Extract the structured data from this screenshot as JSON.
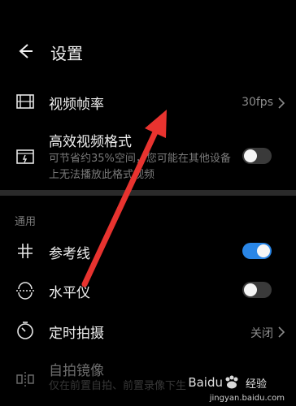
{
  "header": {
    "title": "设置"
  },
  "items": [
    {
      "label": "视频帧率",
      "value": "30fps"
    },
    {
      "label": "高效视频格式",
      "desc": "可节省约35%空间，您可能在其他设备上无法播放此格式视频",
      "toggle_on": false
    },
    {
      "label": "参考线",
      "toggle_on": true
    },
    {
      "label": "水平仪",
      "toggle_on": false
    },
    {
      "label": "定时拍摄",
      "value": "关闭"
    },
    {
      "label": "自拍镜像",
      "desc": "仅在前置自拍、前置录像下生"
    }
  ],
  "section": {
    "label": "通用"
  },
  "watermark": {
    "brand": "Baidu",
    "brand_cn": "经验",
    "url": "jingyan.baidu.com"
  },
  "colors": {
    "accent": "#2a86e6",
    "arrow": "#e8332f",
    "background": "#000000"
  },
  "icons": [
    "back-arrow-icon",
    "film-icon",
    "hevc-icon",
    "grid-icon",
    "level-icon",
    "timer-icon",
    "mirror-icon",
    "chevron-right-icon"
  ]
}
